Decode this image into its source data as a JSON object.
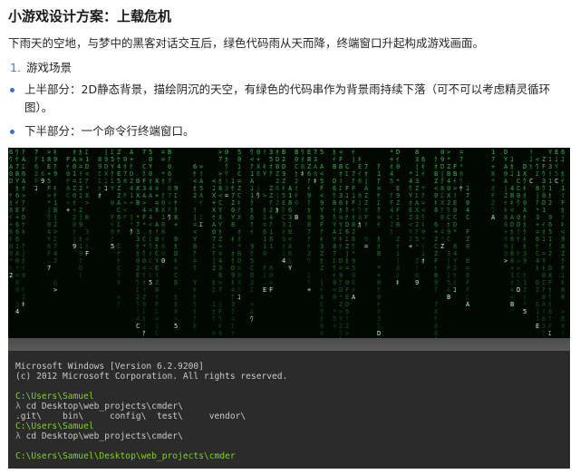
{
  "doc": {
    "title": "小游戏设计方案：上载危机",
    "intro": "下雨天的空地，与梦中的黑客对话交互后，绿色代码雨从天而降，终端窗口升起构成游戏画面。",
    "section_num": "1.",
    "section_title": "游戏场景",
    "bullets": [
      "上半部分：2D静态背景，描绘阴沉的天空，有绿色的代码串作为背景雨持续下落（可不可以考虑精灵循环图）。",
      "下半部分：一个命令行终端窗口。"
    ]
  },
  "screenshot": {
    "rain_color": "#39d353",
    "rain_bright": "#b6ffb0",
    "console": {
      "line1": "Microsoft Windows [Version 6.2.9200]",
      "line2": "(c) 2012 Microsoft Corporation. All rights reserved.",
      "prompt1": "C:\\Users\\Samuel",
      "cmd1_symbol": "λ",
      "cmd1": "cd Desktop\\web_projects\\cmder\\",
      "listing": ".git\\    bin\\     config\\  test\\     vendor\\",
      "prompt2": "C:\\Users\\Samuel",
      "cmd2_symbol": "λ",
      "cmd2": "cd Desktop\\web_projects\\cmder\\",
      "prompt3": "C:\\Users\\Samuel\\Desktop\\web_projects\\cmder"
    }
  }
}
